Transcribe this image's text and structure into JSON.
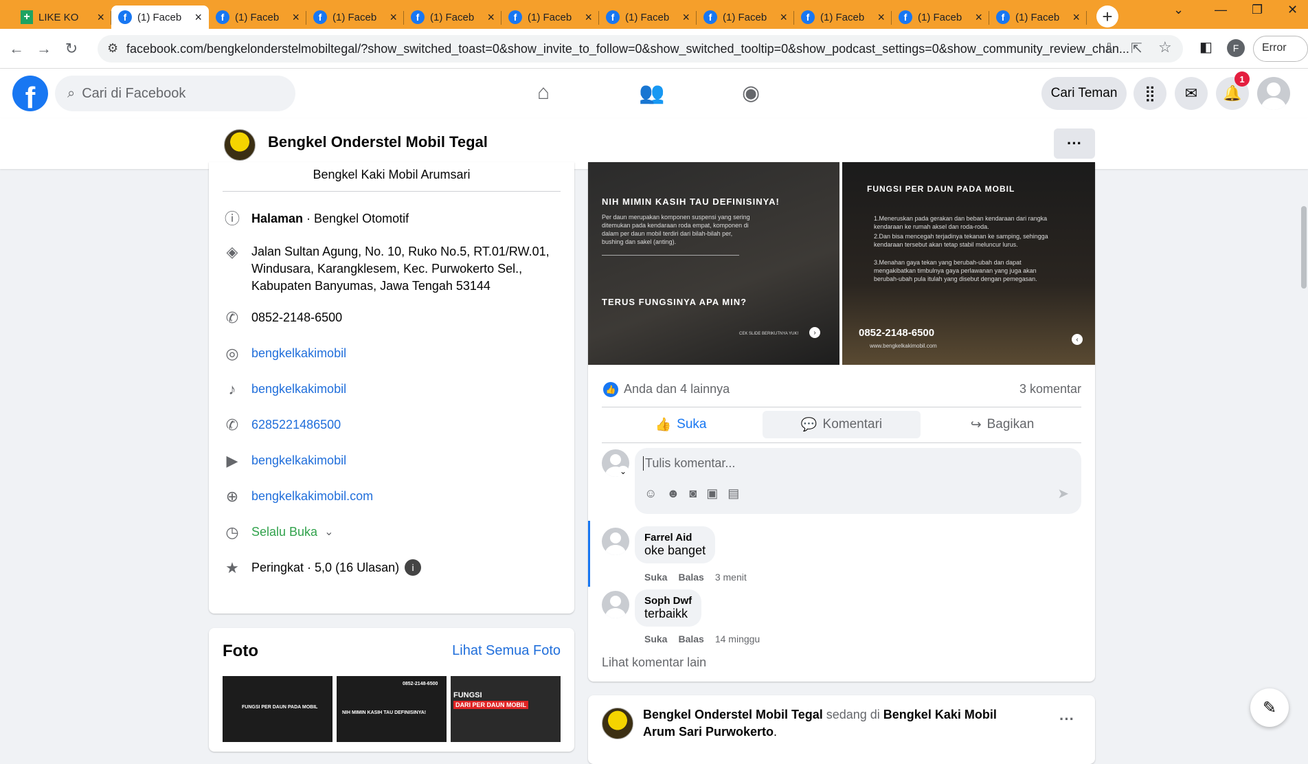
{
  "browser": {
    "tabs": [
      {
        "label": "LIKE KO",
        "type": "sheet"
      },
      {
        "label": "(1) Faceb",
        "type": "fb",
        "active": true
      },
      {
        "label": "(1) Faceb",
        "type": "fb"
      },
      {
        "label": "(1) Faceb",
        "type": "fb"
      },
      {
        "label": "(1) Faceb",
        "type": "fb"
      },
      {
        "label": "(1) Faceb",
        "type": "fb"
      },
      {
        "label": "(1) Faceb",
        "type": "fb"
      },
      {
        "label": "(1) Faceb",
        "type": "fb"
      },
      {
        "label": "(1) Faceb",
        "type": "fb"
      },
      {
        "label": "(1) Faceb",
        "type": "fb"
      },
      {
        "label": "(1) Faceb",
        "type": "fb"
      }
    ],
    "url": "facebook.com/bengkelonderstelmobiltegal/?show_switched_toast=0&show_invite_to_follow=0&show_switched_tooltip=0&show_podcast_settings=0&show_community_review_chan...",
    "profile_letter": "F",
    "error_label": "Error"
  },
  "fb": {
    "logo": "f",
    "search_placeholder": "Cari di Facebook",
    "find_friends": "Cari Teman",
    "notif_count": "1"
  },
  "page": {
    "name": "Bengkel Onderstel Mobil Tegal",
    "more": "···"
  },
  "intro": {
    "subtitle": "Bengkel Kaki Mobil Arumsari",
    "category_bold": "Halaman",
    "category_rest": " · Bengkel Otomotif",
    "address": "Jalan Sultan Agung, No. 10, Ruko No.5, RT.01/RW.01, Windusara, Karangklesem, Kec. Purwokerto Sel., Kabupaten Banyumas, Jawa Tengah 53144",
    "phone": "0852-2148-6500",
    "instagram": "bengkelkakimobil",
    "tiktok": "bengkelkakimobil",
    "whatsapp": "6285221486500",
    "youtube": "bengkelkakimobil",
    "website": "bengkelkakimobil.com",
    "hours": "Selalu Buka",
    "rating": "Peringkat · 5,0 (16 Ulasan)"
  },
  "photos": {
    "title": "Foto",
    "see_all": "Lihat Semua Foto",
    "thumb1_title": "FUNGSI PER DAUN PADA MOBIL",
    "thumb2_title": "NIH MIMIN KASIH TAU DEFINISINYA!",
    "thumb2_phone": "0852-2148-6500",
    "thumb3_title1": "FUNGSI",
    "thumb3_title2": "DARI PER DAUN MOBIL"
  },
  "post": {
    "img1_title": "NIH MIMIN KASIH TAU DEFINISINYA!",
    "img1_body": "Per daun merupakan komponen suspensi yang sering ditemukan pada kendaraan roda empat, komponen di dalam per daun mobil terdiri dari bilah-bilah per, bushing dan sakel (anting).",
    "img1_q": "TERUS FUNGSINYA APA MIN?",
    "img1_cta": "CEK SLIDE BERIKUTNYA YUK!",
    "img2_title": "FUNGSI PER DAUN PADA MOBIL",
    "img2_p1": "1.Meneruskan pada gerakan dan beban kendaraan dari rangka kendaraan ke rumah aksel dan roda-roda.",
    "img2_p2": "2.Dan bisa mencegah terjadinya tekanan ke samping, sehingga kendaraan tersebut akan tetap stabil meluncur lurus.",
    "img2_p3": "3.Menahan gaya tekan yang berubah-ubah dan dapat mengakibatkan timbulnya gaya perlawanan yang juga akan berubah-ubah pula itulah yang disebut dengan pemegasan.",
    "img2_phone": "0852-2148-6500",
    "img2_web": "www.bengkelkakimobil.com",
    "reactions": "Anda dan 4 lainnya",
    "comment_count": "3 komentar",
    "like": "Suka",
    "comment": "Komentari",
    "share": "Bagikan",
    "comment_placeholder": "Tulis komentar...",
    "comments": [
      {
        "name": "Farrel Aid",
        "text": "oke banget",
        "like": "Suka",
        "reply": "Balas",
        "time": "3 menit"
      },
      {
        "name": "Soph Dwf",
        "text": "terbaikk",
        "like": "Suka",
        "reply": "Balas",
        "time": "14 minggu"
      }
    ],
    "more_comments": "Lihat komentar lain"
  },
  "post2": {
    "author": "Bengkel Onderstel Mobil Tegal",
    "mid": " sedang di ",
    "place": "Bengkel Kaki Mobil Arum Sari Purwokerto",
    "end": "."
  }
}
